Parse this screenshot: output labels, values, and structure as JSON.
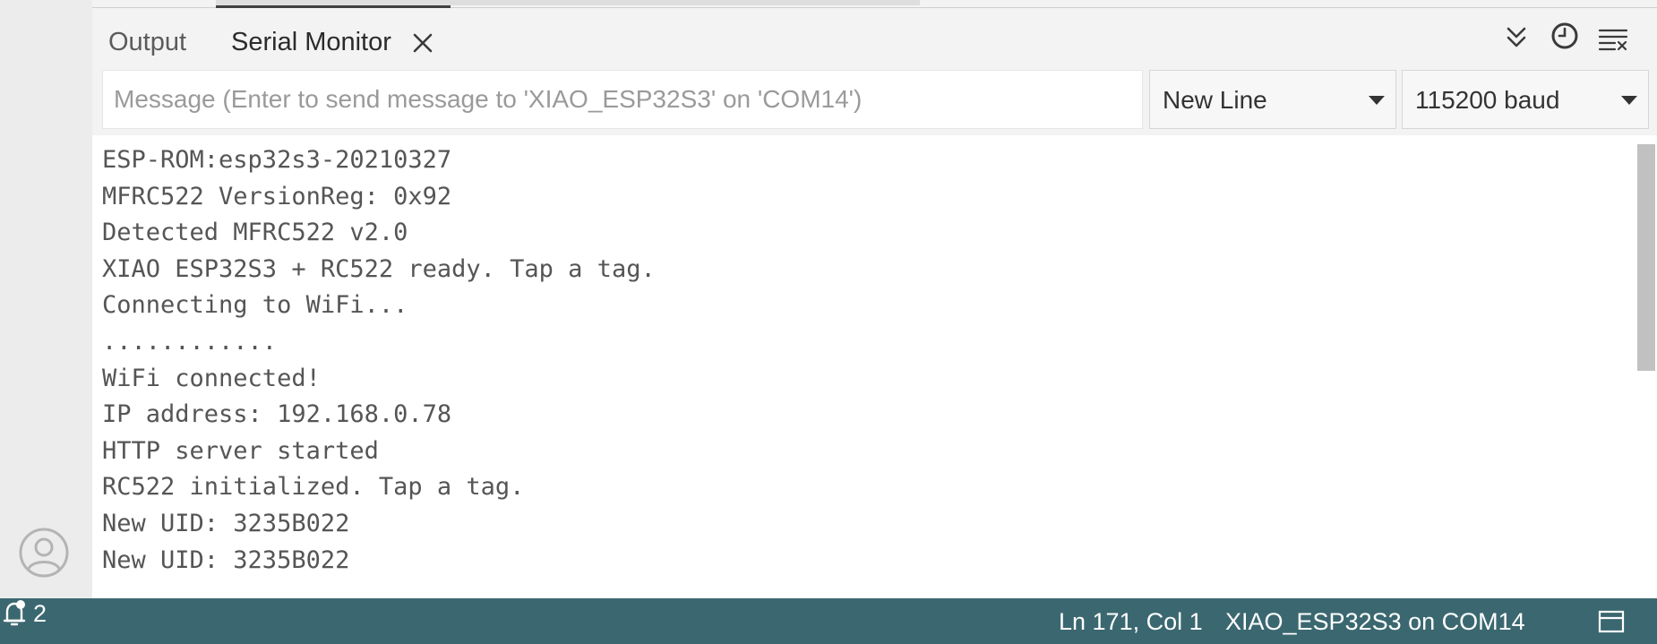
{
  "tabs": {
    "output_label": "Output",
    "serial_label": "Serial Monitor"
  },
  "toolbar_icons": [
    "autoscroll-icon",
    "timestamp-clock-icon",
    "clear-output-icon"
  ],
  "message": {
    "placeholder": "Message (Enter to send message to 'XIAO_ESP32S3' on 'COM14')",
    "value": ""
  },
  "line_ending": {
    "selected": "New Line"
  },
  "baud_rate": {
    "selected": "115200 baud"
  },
  "console": {
    "lines": [
      "ESP-ROM:esp32s3-20210327",
      "MFRC522 VersionReg: 0x92",
      "Detected MFRC522 v2.0",
      "XIAO ESP32S3 + RC522 ready. Tap a tag.",
      "Connecting to WiFi...",
      "............",
      "WiFi connected!",
      "IP address: 192.168.0.78",
      "HTTP server started",
      "RC522 initialized. Tap a tag.",
      "New UID: 3235B022",
      "New UID: 3235B022"
    ]
  },
  "statusbar": {
    "cursor_position": "Ln 171, Col 1",
    "board_port": "XIAO_ESP32S3 on COM14",
    "notification_count": "2"
  },
  "colors": {
    "statusbar_bg": "#3b6870",
    "console_text": "#555555",
    "panel_bg": "#f3f3f3"
  }
}
